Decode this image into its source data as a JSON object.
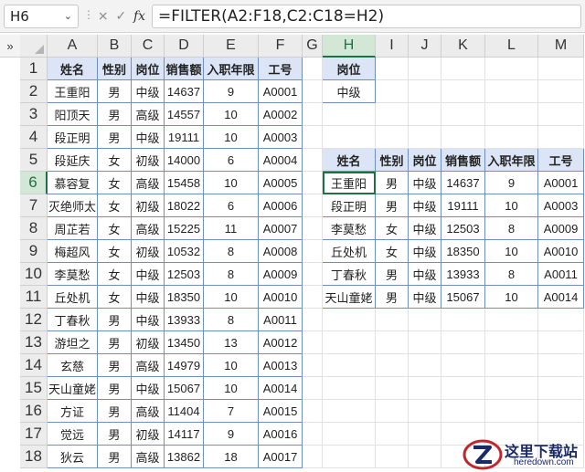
{
  "formula_bar": {
    "name_box": "H6",
    "name_box_arrow": "⌄",
    "cancel_icon": "×",
    "enter_icon": "✓",
    "fx_label": "fx",
    "formula": "=FILTER(A2:F18,C2:C18=H2)"
  },
  "expand_toggle": "»",
  "columns": [
    "A",
    "B",
    "C",
    "D",
    "E",
    "F",
    "G",
    "H",
    "I",
    "J",
    "K",
    "L",
    "M"
  ],
  "selected_column": "H",
  "selected_row": 6,
  "rows": [
    "1",
    "2",
    "3",
    "4",
    "5",
    "6",
    "7",
    "8",
    "9",
    "10",
    "11",
    "12",
    "13",
    "14",
    "15",
    "16",
    "17",
    "18"
  ],
  "source_table": {
    "headers": [
      "姓名",
      "性别",
      "岗位",
      "销售额",
      "入职年限",
      "工号"
    ],
    "rows": [
      [
        "王重阳",
        "男",
        "中级",
        "14637",
        "9",
        "A0001"
      ],
      [
        "阳顶天",
        "男",
        "高级",
        "14557",
        "10",
        "A0002"
      ],
      [
        "段正明",
        "男",
        "中级",
        "19111",
        "10",
        "A0003"
      ],
      [
        "段延庆",
        "女",
        "初级",
        "14000",
        "6",
        "A0004"
      ],
      [
        "慕容复",
        "女",
        "高级",
        "15458",
        "10",
        "A0005"
      ],
      [
        "灭绝师太",
        "女",
        "初级",
        "18022",
        "6",
        "A0006"
      ],
      [
        "周芷若",
        "女",
        "高级",
        "15225",
        "11",
        "A0007"
      ],
      [
        "梅超风",
        "女",
        "初级",
        "10532",
        "8",
        "A0008"
      ],
      [
        "李莫愁",
        "女",
        "中级",
        "12503",
        "8",
        "A0009"
      ],
      [
        "丘处机",
        "女",
        "中级",
        "18350",
        "10",
        "A0010"
      ],
      [
        "丁春秋",
        "男",
        "中级",
        "13933",
        "8",
        "A0011"
      ],
      [
        "游坦之",
        "男",
        "初级",
        "13450",
        "13",
        "A0012"
      ],
      [
        "玄慈",
        "男",
        "高级",
        "14979",
        "10",
        "A0013"
      ],
      [
        "天山童姥",
        "男",
        "中级",
        "15067",
        "10",
        "A0014"
      ],
      [
        "方证",
        "男",
        "高级",
        "11404",
        "7",
        "A0015"
      ],
      [
        "觉远",
        "男",
        "初级",
        "14117",
        "9",
        "A0016"
      ],
      [
        "狄云",
        "男",
        "高级",
        "13862",
        "18",
        "A0017"
      ]
    ]
  },
  "criteria": {
    "header": "岗位",
    "value": "中级"
  },
  "result_table": {
    "headers": [
      "姓名",
      "性别",
      "岗位",
      "销售额",
      "入职年限",
      "工号"
    ],
    "rows": [
      [
        "王重阳",
        "男",
        "中级",
        "14637",
        "9",
        "A0001"
      ],
      [
        "段正明",
        "男",
        "中级",
        "19111",
        "10",
        "A0003"
      ],
      [
        "李莫愁",
        "女",
        "中级",
        "12503",
        "8",
        "A0009"
      ],
      [
        "丘处机",
        "女",
        "中级",
        "18350",
        "10",
        "A0010"
      ],
      [
        "丁春秋",
        "男",
        "中级",
        "13933",
        "8",
        "A0011"
      ],
      [
        "天山童姥",
        "男",
        "中级",
        "15067",
        "10",
        "A0014"
      ]
    ]
  },
  "watermark": {
    "title": "这里下载站",
    "url": "heredown.com"
  },
  "colors": {
    "selection": "#1e7145",
    "table_border": "#6f8fc0",
    "table_header_bg": "#dbe5f5",
    "header_bg": "#ececec"
  }
}
